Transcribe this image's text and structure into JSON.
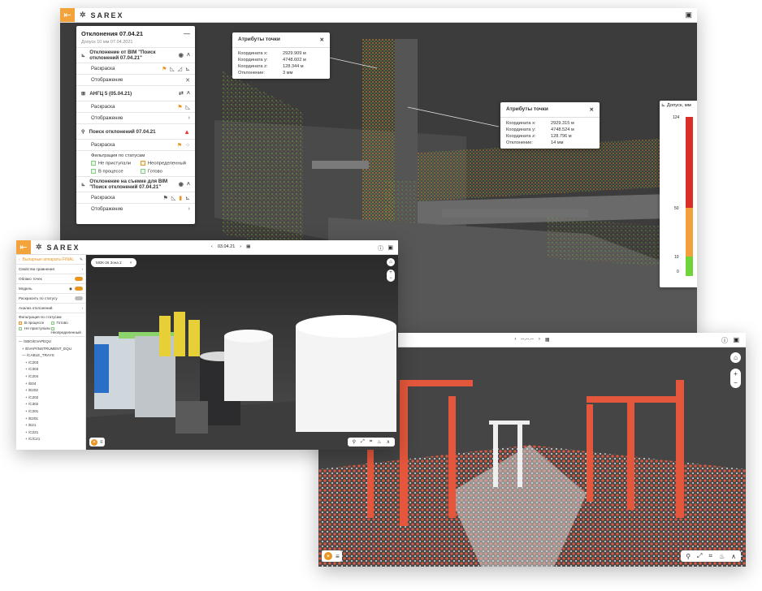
{
  "app": {
    "logo": "SAREX"
  },
  "win1": {
    "panel": {
      "title": "Отклонения 07.04.21",
      "subtitle": "Допуск 10 мм 07.04.2021",
      "rows": [
        {
          "type": "h",
          "label": "Отклонение от BIM \"Поиск отклонений 07.04.21\""
        },
        {
          "type": "s",
          "label": "Раскраска"
        },
        {
          "type": "s",
          "label": "Отображение"
        },
        {
          "type": "h",
          "label": "АНГЦ 5 (05.04.21)"
        },
        {
          "type": "s",
          "label": "Раскраска"
        },
        {
          "type": "s",
          "label": "Отображение"
        },
        {
          "type": "h",
          "label": "Поиск отклонений 07.04.21"
        },
        {
          "type": "s",
          "label": "Раскраска"
        }
      ],
      "filter_title": "Фильтрация по статусам",
      "filters": [
        "Не приступали",
        "Неопределенный",
        "В процессе",
        "Готово"
      ],
      "rows2": [
        {
          "type": "h",
          "label": "Отклонение на съемке для BIM \"Поиск отклонений 07.04.21\""
        },
        {
          "type": "s",
          "label": "Раскраска"
        },
        {
          "type": "s",
          "label": "Отображение"
        }
      ]
    },
    "attr1": {
      "title": "Атрибуты точки",
      "rows": [
        [
          "Координата x:",
          "2929.909 м"
        ],
        [
          "Координата y:",
          "4748.602 м"
        ],
        [
          "Координата z:",
          "128.344 м"
        ],
        [
          "Отклонение:",
          "3 мм"
        ]
      ]
    },
    "attr2": {
      "title": "Атрибуты точки",
      "rows": [
        [
          "Координата x:",
          "2929.315 м"
        ],
        [
          "Координата y:",
          "4748.524 м"
        ],
        [
          "Координата z:",
          "128.796 м"
        ],
        [
          "Отклонение:",
          "14 мм"
        ]
      ]
    },
    "legend": {
      "title": "Допуск, мм",
      "ticks": [
        "124",
        "50",
        "10",
        "0"
      ]
    }
  },
  "win2": {
    "date": "03.04.21",
    "panel": {
      "title": "Выпарные аппараты FINAL",
      "rows": [
        "Свойства сравнения",
        "Облако точек",
        "Модель",
        "Раскрасить по статусу",
        "Анализ отклонений"
      ],
      "filter_title": "Фильтрация по статусам",
      "filters": [
        "В процессе",
        "Готово",
        "Не приступали",
        "Неопределенный"
      ],
      "tree": [
        "/SBG/EVAPEQU",
        "/EVAP/INSTRUMENT_EQU",
        "/CABLE_TRAYS",
        "/C203",
        "/C303",
        "/C204",
        "/E04",
        "/E202",
        "/C202",
        "/C302",
        "/C201",
        "/E201",
        "/E21",
        "/C221",
        "/C/C21",
        "/C/C211"
      ]
    },
    "dropdown": "МОК-26 Зона 2"
  },
  "win3": {
    "date": "--.--.--"
  }
}
